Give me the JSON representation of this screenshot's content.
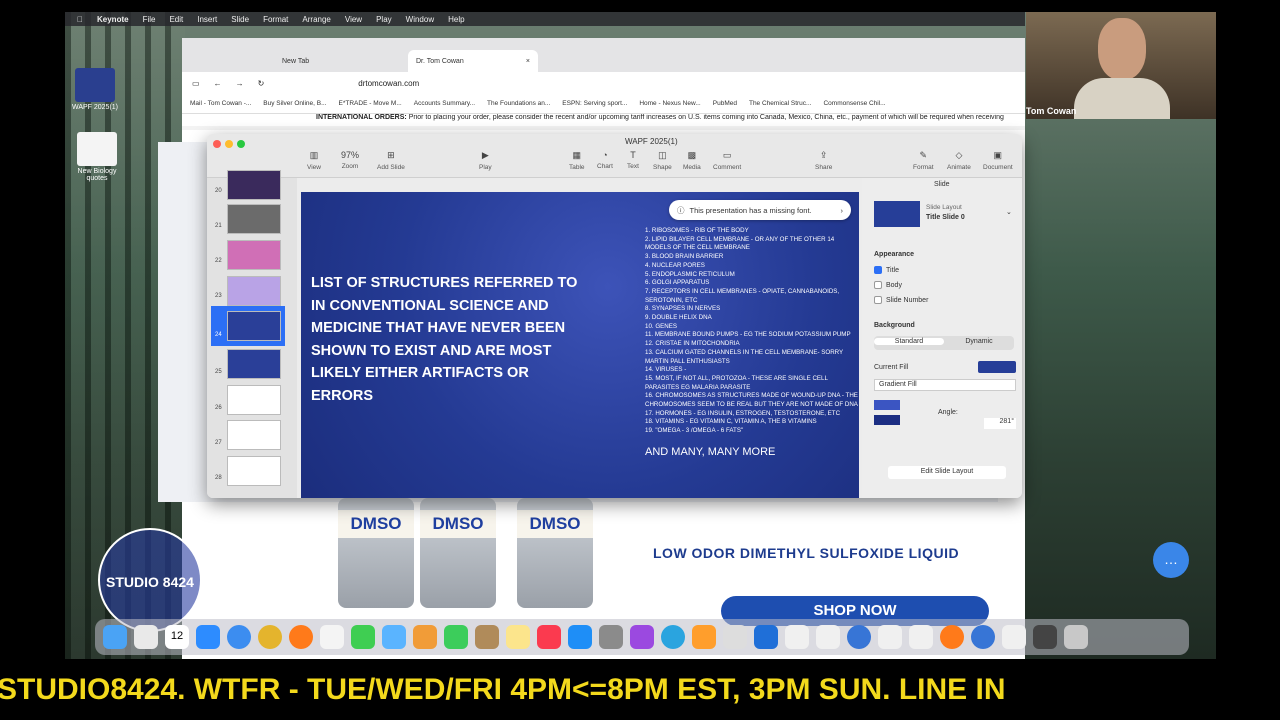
{
  "menubar": {
    "app": "Keynote",
    "items": [
      "File",
      "Edit",
      "Insert",
      "Slide",
      "Format",
      "Arrange",
      "View",
      "Play",
      "Window",
      "Help"
    ]
  },
  "desktop": {
    "icon1": "WAPF 2025(1)",
    "icon2": "New Biology quotes"
  },
  "browser": {
    "tabs": [
      "New Tab",
      "Dr. Tom Cowan"
    ],
    "url": "drtomcowan.com",
    "bookmarks": [
      "Mail - Tom Cowan -...",
      "Buy Silver Online, B...",
      "E*TRADE - Move M...",
      "Accounts Summary...",
      "The Foundations an...",
      "ESPN: Serving sport...",
      "Home - Nexus New...",
      "PubMed",
      "The Chemical Struc...",
      "Commonsense Chil..."
    ],
    "notice_bold": "INTERNATIONAL ORDERS:",
    "notice": " Prior to placing your order, please consider the recent and/or upcoming tariff increases on U.S. items coming into Canada, Mexico, China, etc., payment of which will be required when receiving"
  },
  "webpage": {
    "hero_sub": "LOW ODOR DIMETHYL SULFOXIDE LIQUID",
    "shop": "SHOP NOW",
    "bottle": "DMSO"
  },
  "keynote": {
    "title": "WAPF 2025(1)",
    "toolbar": [
      "View",
      "Zoom",
      "Add Slide",
      "Play",
      "Table",
      "Chart",
      "Text",
      "Shape",
      "Media",
      "Comment",
      "Share",
      "Format",
      "Animate",
      "Document"
    ],
    "zoom": "97%",
    "thumb_nums": [
      "20",
      "21",
      "22",
      "23",
      "24",
      "25",
      "26",
      "27",
      "28"
    ],
    "toast": "This presentation has a missing font.",
    "slide_title": "LIST OF STRUCTURES REFERRED TO IN CONVENTIONAL SCIENCE AND MEDICINE THAT HAVE NEVER BEEN SHOWN TO EXIST AND ARE MOST LIKELY EITHER ARTIFACTS OR ERRORS",
    "list": [
      "1. RIBOSOMES - RIB OF THE BODY",
      "2. LIPID BILAYER CELL MEMBRANE - OR ANY OF THE OTHER 14 MODELS OF THE CELL MEMBRANE",
      "3. BLOOD BRAIN BARRIER",
      "4. NUCLEAR PORES",
      "5. ENDOPLASMIC RETICULUM",
      "6. GOLGI APPARATUS",
      "7. RECEPTORS IN CELL MEMBRANES - OPIATE, CANNABANOIDS, SEROTONIN, ETC",
      "8. SYNAPSES IN NERVES",
      "9. DOUBLE HELIX DNA",
      "10. GENES",
      "11. MEMBRANE BOUND PUMPS - EG THE SODIUM POTASSIUM PUMP",
      "12. CRISTAE IN MITOCHONDRIA",
      "13. CALCIUM GATED CHANNELS IN THE CELL MEMBRANE- SORRY MARTIN PALL ENTHUSIASTS",
      "14. VIRUSES -",
      "15. MOST, IF NOT ALL, PROTOZOA - THESE ARE SINGLE CELL PARASITES EG MALARIA PARASITE",
      "16. CHROMOSOMES AS STRUCTURES MADE OF WOUND-UP DNA - THE CHROMOSOMES SEEM TO BE REAL BUT THEY ARE NOT MADE OF DNA",
      "17. HORMONES - EG INSULIN, ESTROGEN, TESTOSTERONE, ETC",
      "18. VITAMINS - EG VITAMIN C, VITAMIN A, THE B VITAMINS",
      "19. \"OMEGA - 3 /OMEGA - 6 FATS\""
    ],
    "more": "AND MANY, MANY MORE",
    "inspector": {
      "tab": "Slide",
      "layout_label": "Slide Layout",
      "layout": "Title Slide 0",
      "appearance": "Appearance",
      "title": "Title",
      "body": "Body",
      "slide_number": "Slide Number",
      "background": "Background",
      "standard": "Standard",
      "dynamic": "Dynamic",
      "current_fill": "Current Fill",
      "fill_type": "Gradient Fill",
      "angle_label": "Angle:",
      "angle": "281°",
      "edit_layout": "Edit Slide Layout"
    }
  },
  "camera": {
    "name": "Tom Cowan"
  },
  "dock": {
    "calendar_day": "12"
  },
  "studio": "STUDIO 8424",
  "ticker": "STUDIO8424.   WTFR - TUE/WED/FRI 4PM<=8PM EST, 3PM SUN. LINE IN"
}
